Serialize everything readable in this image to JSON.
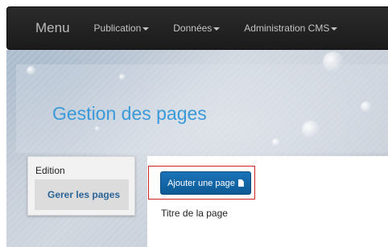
{
  "navbar": {
    "brand": "Menu",
    "items": [
      {
        "label": "Publication"
      },
      {
        "label": "Données"
      },
      {
        "label": "Administration CMS"
      }
    ]
  },
  "hero": {
    "title": "Gestion des pages"
  },
  "sidebar": {
    "heading": "Edition",
    "items": [
      {
        "label": "Gerer les pages"
      }
    ]
  },
  "main": {
    "add_button_label": "Ajouter une page",
    "add_button_icon": "file-icon",
    "table": {
      "columns": [
        "Titre de la page"
      ]
    }
  },
  "colors": {
    "navbar_bg": "#222222",
    "title_blue": "#3a9ad9",
    "button_blue": "#1a73b8",
    "link_blue": "#2a6496",
    "highlight_red": "#cc2222"
  }
}
